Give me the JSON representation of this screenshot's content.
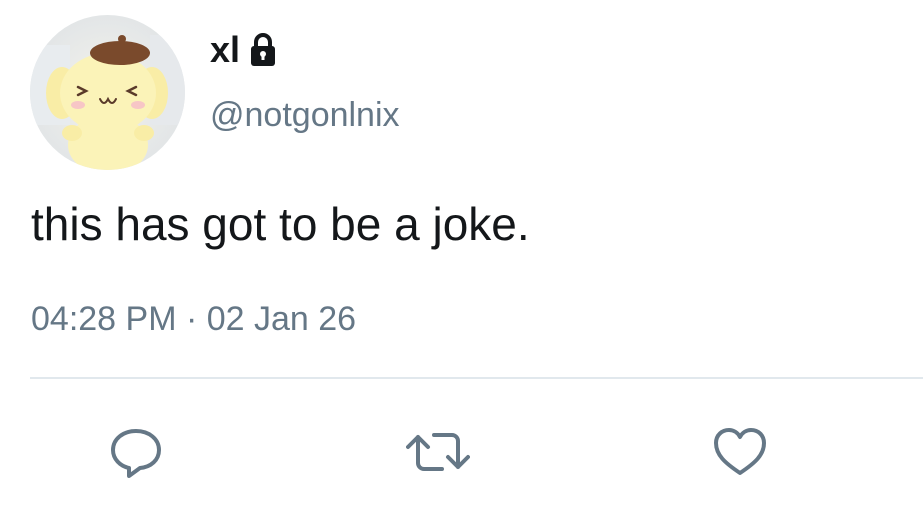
{
  "user": {
    "display_name": "xl",
    "handle": "@notgonlnix",
    "verified_icon": "lock-icon",
    "avatar": "pompompurin-avatar"
  },
  "tweet": {
    "text": "this has got to be a joke.",
    "timestamp": "04:28 PM · 02 Jan 26"
  },
  "actions": {
    "reply_icon": "reply-icon",
    "retweet_icon": "retweet-icon",
    "like_icon": "like-icon"
  },
  "colors": {
    "primary_text": "#14171a",
    "secondary_text": "#657786",
    "divider": "#e1e8ed",
    "icon": "#657786"
  }
}
